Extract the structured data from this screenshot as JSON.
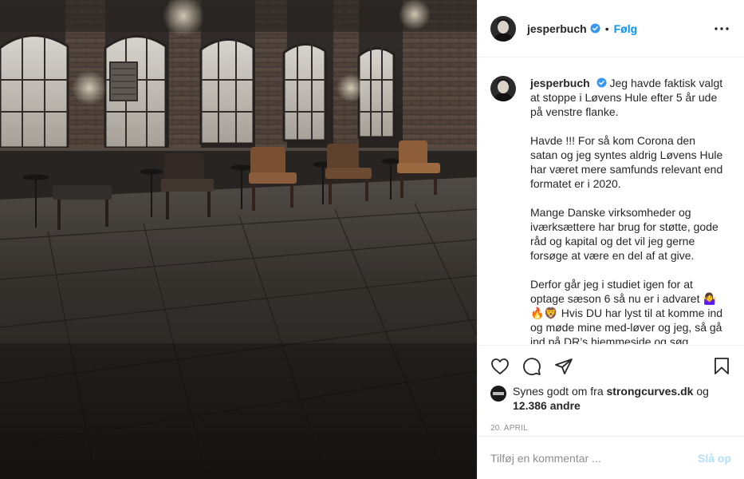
{
  "post": {
    "username": "jesperbuch",
    "verified": true,
    "follow_label": "Følg",
    "dot": "•",
    "image_alt": "Dark studio set with five empty leather armchairs in front of arched windows on a wooden floor",
    "caption": [
      "Jeg havde faktisk valgt at stoppe i Løvens Hule efter 5 år ude på venstre flanke.",
      "Havde !!! For så kom Corona den satan og jeg syntes aldrig Løvens Hule har været mere samfunds relevant end formatet er i 2020.",
      "Mange Danske virksomheder og iværksættere har brug for støtte, gode råd og kapital og det vil jeg gerne forsøge at være en del af at give.",
      "Derfor går jeg i studiet igen for at optage sæson 6 så nu er i advaret 🤷‍♀️🔥🦁 Hvis DU har lyst til at komme ind og møde mine med-løver og jeg, så gå ind på DR’s hjemmeside og søg"
    ],
    "likes": {
      "prefix": "Synes godt om fra",
      "liker": "strongcurves.dk",
      "joiner": "og",
      "count": "12.386 andre"
    },
    "date": "20. APRIL",
    "comment_placeholder": "Tilføj en kommentar ...",
    "post_label": "Slå op"
  },
  "icons": {
    "more": "more-options-icon",
    "like": "heart-icon",
    "comment": "comment-icon",
    "share": "share-icon",
    "save": "bookmark-icon",
    "verified": "verified-badge-icon"
  },
  "colors": {
    "accent": "#0095f6",
    "post_disabled": "#b2dffc",
    "verified": "#3897f0",
    "border": "#efefef",
    "muted": "#8e8e8e"
  }
}
